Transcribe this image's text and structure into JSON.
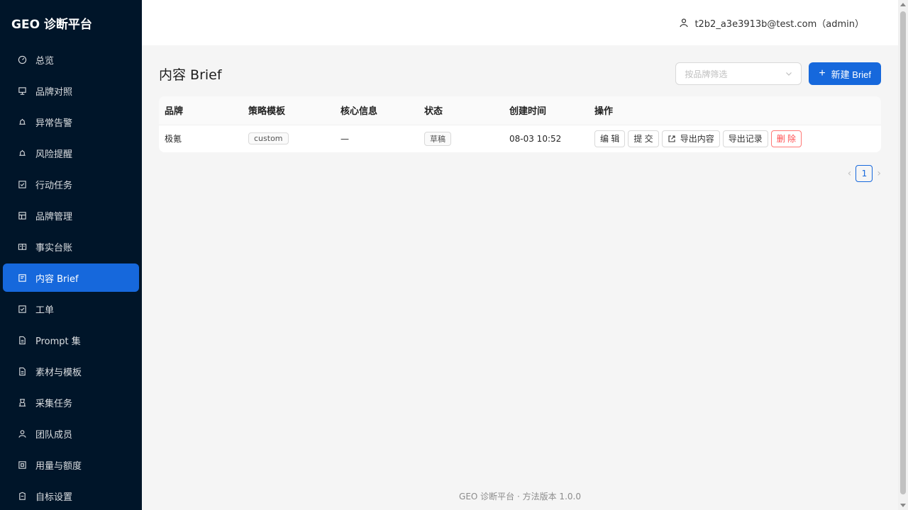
{
  "app": {
    "title": "GEO 诊断平台"
  },
  "sidebar": {
    "items": [
      {
        "label": "总览",
        "icon": "dashboard-icon"
      },
      {
        "label": "品牌对照",
        "icon": "compare-icon"
      },
      {
        "label": "异常告警",
        "icon": "alert-icon"
      },
      {
        "label": "风险提醒",
        "icon": "bell-icon"
      },
      {
        "label": "行动任务",
        "icon": "checkbox-icon"
      },
      {
        "label": "品牌管理",
        "icon": "brand-icon"
      },
      {
        "label": "事实台账",
        "icon": "ledger-icon"
      },
      {
        "label": "内容 Brief",
        "icon": "brief-icon",
        "active": true
      },
      {
        "label": "工单",
        "icon": "ticket-icon"
      },
      {
        "label": "Prompt 集",
        "icon": "file-icon"
      },
      {
        "label": "素材与模板",
        "icon": "file-icon"
      },
      {
        "label": "采集任务",
        "icon": "collect-icon"
      },
      {
        "label": "团队成员",
        "icon": "team-icon"
      },
      {
        "label": "用量与额度",
        "icon": "quota-icon"
      },
      {
        "label": "自标设置",
        "icon": "settings-icon"
      }
    ]
  },
  "header": {
    "user": "t2b2_a3e3913b@test.com（admin）"
  },
  "page": {
    "title": "内容 Brief",
    "filter_placeholder": "按品牌筛选",
    "new_button": "新建 Brief"
  },
  "table": {
    "columns": [
      "品牌",
      "策略模板",
      "核心信息",
      "状态",
      "创建时间",
      "操作"
    ],
    "rows": [
      {
        "brand": "极氪",
        "template": "custom",
        "core": "—",
        "status": "草稿",
        "created": "08-03 10:52",
        "ops": {
          "edit": "编 辑",
          "submit": "提 交",
          "export_content": "导出内容",
          "export_record": "导出记录",
          "delete": "删 除"
        }
      }
    ]
  },
  "pagination": {
    "current": "1",
    "prev": "‹",
    "next": "›"
  },
  "footer": {
    "text": "GEO 诊断平台 · 方法版本 1.0.0"
  },
  "colors": {
    "sidebar_bg": "#001529",
    "primary": "#1668dc",
    "danger": "#ff4d4f"
  }
}
